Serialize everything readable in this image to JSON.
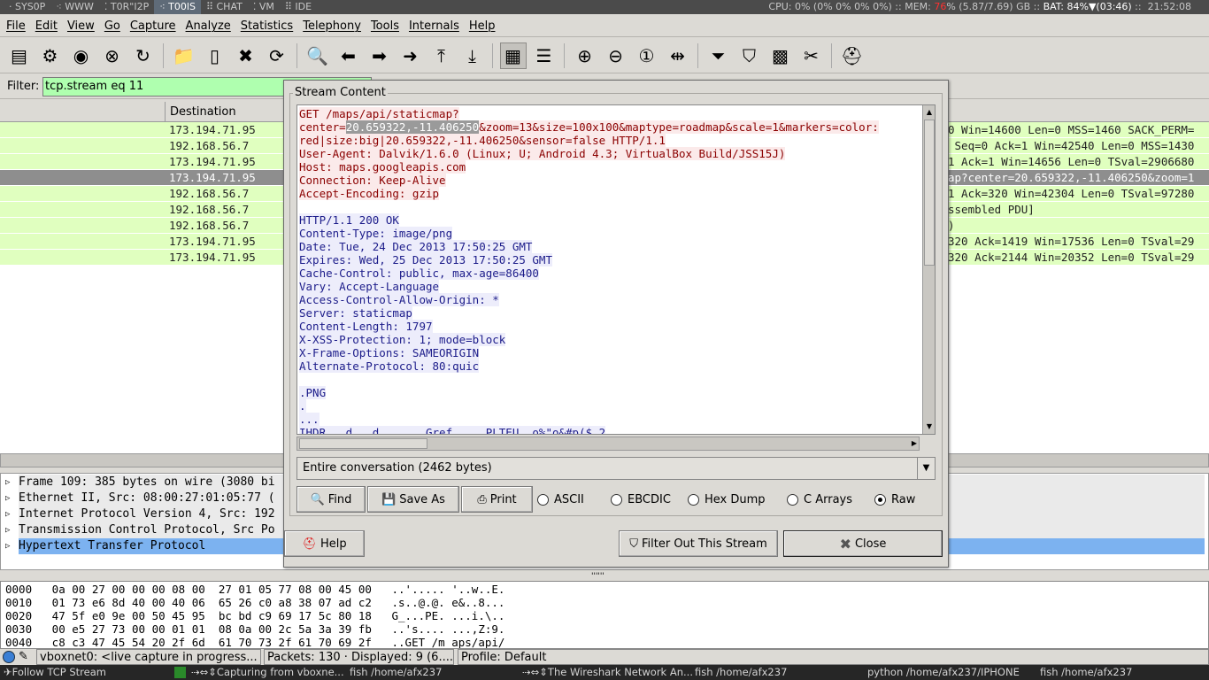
{
  "topbar": {
    "workspaces": [
      "SYS0P",
      "WWW",
      "T0R\"I2P",
      "T00lS",
      "CHAT",
      "VM",
      "IDE"
    ],
    "active_workspace": "T00lS",
    "cpu": "CPU: 0% (0% 0% 0% 0%)",
    "mem_label": "MEM:",
    "mem_value": "76",
    "mem_rest": "% (5.87/7.69) GB",
    "bat": "BAT: 84%▼(03:46)",
    "clock": "21:52:08"
  },
  "menu": [
    "File",
    "Edit",
    "View",
    "Go",
    "Capture",
    "Analyze",
    "Statistics",
    "Telephony",
    "Tools",
    "Internals",
    "Help"
  ],
  "toolbar": [
    {
      "icon": "interfaces-icon",
      "g": "▤"
    },
    {
      "icon": "capture-options-icon",
      "g": "⚙"
    },
    {
      "icon": "start-capture-icon",
      "g": "◉"
    },
    {
      "icon": "stop-capture-icon",
      "g": "⊗"
    },
    {
      "icon": "restart-capture-icon",
      "g": "↻"
    },
    {
      "sep": true
    },
    {
      "icon": "open-file-icon",
      "g": "📁"
    },
    {
      "icon": "save-file-icon",
      "g": "▯"
    },
    {
      "icon": "close-file-icon",
      "g": "✖"
    },
    {
      "icon": "reload-icon",
      "g": "⟳"
    },
    {
      "sep": true
    },
    {
      "icon": "find-packet-icon",
      "g": "🔍"
    },
    {
      "icon": "go-back-icon",
      "g": "⬅"
    },
    {
      "icon": "go-forward-icon",
      "g": "➡"
    },
    {
      "icon": "go-to-packet-icon",
      "g": "➜"
    },
    {
      "icon": "go-first-icon",
      "g": "⤒"
    },
    {
      "icon": "go-last-icon",
      "g": "⤓"
    },
    {
      "sep": true
    },
    {
      "icon": "colorize-icon",
      "g": "▦",
      "pressed": true
    },
    {
      "icon": "autoscroll-icon",
      "g": "☰"
    },
    {
      "sep": true
    },
    {
      "icon": "zoom-in-icon",
      "g": "⊕"
    },
    {
      "icon": "zoom-out-icon",
      "g": "⊖"
    },
    {
      "icon": "zoom-normal-icon",
      "g": "①"
    },
    {
      "icon": "resize-columns-icon",
      "g": "⇹"
    },
    {
      "sep": true
    },
    {
      "icon": "capture-filters-icon",
      "g": "⏷"
    },
    {
      "icon": "display-filters-icon",
      "g": "⛉"
    },
    {
      "icon": "coloring-rules-icon",
      "g": "▩"
    },
    {
      "icon": "preferences-icon",
      "g": "✂"
    },
    {
      "sep": true
    },
    {
      "icon": "help-icon",
      "g": "⛑"
    }
  ],
  "filter": {
    "label": "Filter:",
    "value": "tcp.stream eq 11"
  },
  "packet_list": {
    "columns": [
      "",
      "Destination"
    ],
    "rows": [
      {
        "destination": "173.194.71.95",
        "info": "0 Win=14600 Len=0 MSS=1460 SACK_PERM="
      },
      {
        "destination": "192.168.56.7",
        "info": " Seq=0 Ack=1 Win=42540 Len=0 MSS=1430"
      },
      {
        "destination": "173.194.71.95",
        "info": "1 Ack=1 Win=14656 Len=0 TSval=2906680"
      },
      {
        "destination": "173.194.71.95",
        "info": "ap?center=20.659322,-11.406250&zoom=1",
        "selected": true
      },
      {
        "destination": "192.168.56.7",
        "info": "1 Ack=320 Win=42304 Len=0 TSval=97280"
      },
      {
        "destination": "192.168.56.7",
        "info": "ssembled PDU]"
      },
      {
        "destination": "192.168.56.7",
        "info": ")"
      },
      {
        "destination": "173.194.71.95",
        "info": "320 Ack=1419 Win=17536 Len=0 TSval=29"
      },
      {
        "destination": "173.194.71.95",
        "info": "320 Ack=2144 Win=20352 Len=0 TSval=29"
      }
    ]
  },
  "details": [
    {
      "text": "Frame 109: 385 bytes on wire (3080 bi"
    },
    {
      "text": "Ethernet II, Src: 08:00:27:01:05:77 ("
    },
    {
      "text": "Internet Protocol Version 4, Src: 192"
    },
    {
      "text": "Transmission Control Protocol, Src Po"
    },
    {
      "text": "Hypertext Transfer Protocol",
      "selected": true
    }
  ],
  "hex": [
    "0000   0a 00 27 00 00 00 08 00  27 01 05 77 08 00 45 00   ..'..... '..w..E.",
    "0010   01 73 e6 8d 40 00 40 06  65 26 c0 a8 38 07 ad c2   .s..@.@. e&..8...",
    "0020   47 5f e0 9e 00 50 45 95  bc bd c9 69 17 5c 80 18   G_...PE. ...i.\\..",
    "0030   00 e5 27 73 00 00 01 01  08 0a 00 2c 5a 3a 39 fb   ..'s.... ...,Z:9.",
    "0040   c8 c3 47 45 54 20 2f 6d  61 70 73 2f 61 70 69 2f   ..GET /m aps/api/"
  ],
  "statusbar": {
    "capture": "vboxnet0: <live capture in progress...",
    "packets": "Packets: 130 · Displayed: 9 (6....",
    "profile": "Profile: Default"
  },
  "taskbar": {
    "active": "Follow TCP Stream",
    "items": [
      "Capturing from vboxne...",
      "fish  /home/afx237",
      "The Wireshark Network An...",
      "fish  /home/afx237",
      "python  /home/afx237/IPHONE",
      "fish  /home/afx237"
    ]
  },
  "dialog": {
    "frame_label": "Stream Content",
    "request_lines": [
      "GET /maps/api/staticmap?",
      "center=|20.659322,-11.406250|&zoom=13&size=100x100&maptype=roadmap&scale=1&markers=color:",
      "red|size:big|20.659322,-11.406250&sensor=false HTTP/1.1",
      "User-Agent: Dalvik/1.6.0 (Linux; U; Android 4.3; VirtualBox Build/JSS15J)",
      "Host: maps.googleapis.com",
      "Connection: Keep-Alive",
      "Accept-Encoding: gzip",
      ""
    ],
    "response_lines": [
      "HTTP/1.1 200 OK",
      "Content-Type: image/png",
      "Date: Tue, 24 Dec 2013 17:50:25 GMT",
      "Expires: Wed, 25 Dec 2013 17:50:25 GMT",
      "Cache-Control: public, max-age=86400",
      "Vary: Accept-Language",
      "Access-Control-Allow-Origin: *",
      "Server: staticmap",
      "Content-Length: 1797",
      "X-XSS-Protection: 1; mode=block",
      "X-Frame-Options: SAMEORIGIN",
      "Alternate-Protocol: 80:quic",
      "",
      ".PNG",
      ".",
      "...",
      "IHDR...d...d.......Gref.....PLTEU..o%\"o&#p($.2"
    ],
    "conversation": "Entire conversation (2462 bytes)",
    "find": "Find",
    "save_as": "Save As",
    "print": "Print",
    "formats": [
      "ASCII",
      "EBCDIC",
      "Hex Dump",
      "C Arrays",
      "Raw"
    ],
    "selected_format": "Raw",
    "help": "Help",
    "filter_out": "Filter Out This Stream",
    "close": "Close",
    "colors": {
      "client": "#8b0000",
      "server": "#1c1c8a"
    }
  }
}
